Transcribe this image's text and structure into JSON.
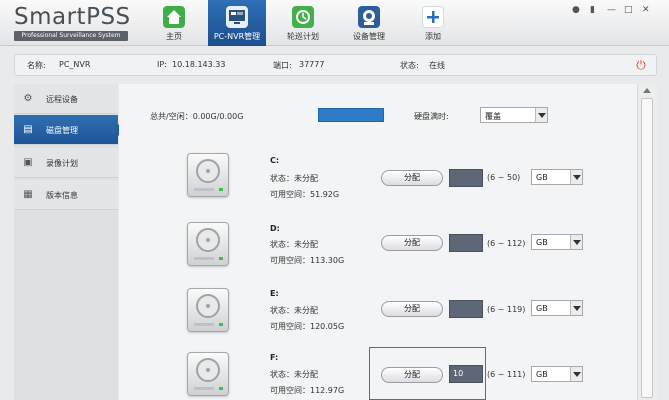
{
  "app": {
    "logo_title": "SmartPSS",
    "logo_subtitle": "Professional Surveillance System"
  },
  "nav": [
    {
      "label": "主页",
      "icon": "home-icon",
      "color": "#3fae49"
    },
    {
      "label": "PC-NVR管理",
      "icon": "pc-nvr-icon",
      "color": "#2c4f7c"
    },
    {
      "label": "轮巡计划",
      "icon": "patrol-schedule-icon",
      "color": "#43b14b"
    },
    {
      "label": "设备管理",
      "icon": "camera-device-icon",
      "color": "#2f5d9a"
    },
    {
      "label": "添加",
      "icon": "add-icon",
      "color": "#2a6fbf"
    }
  ],
  "window_controls": [
    "user-icon",
    "lock-icon",
    "minimize-icon",
    "restore-icon",
    "close-icon"
  ],
  "info": {
    "name_label": "名称:",
    "name_value": "PC_NVR",
    "ip_label": "IP:",
    "ip_value": "10.18.143.33",
    "port_label": "端口:",
    "port_value": "37777",
    "status_label": "状态:",
    "status_value": "在线"
  },
  "sidebar": [
    {
      "label": "远程设备",
      "icon": "gear-icon",
      "active": false
    },
    {
      "label": "磁盘管理",
      "icon": "disk-icon",
      "active": true
    },
    {
      "label": "录像计划",
      "icon": "record-schedule-icon",
      "active": false
    },
    {
      "label": "版本信息",
      "icon": "info-icon",
      "active": false
    }
  ],
  "disk": {
    "total_label": "总共/空闲：0.00G/0.00G",
    "full_label": "硬盘满时:",
    "full_option": "覆盖",
    "drives": [
      {
        "name": "C:",
        "status": "状态：未分配",
        "space": "可用空间：51.92G",
        "button": "分配",
        "size": "",
        "range": "(6 ~ 50)",
        "unit": "GB"
      },
      {
        "name": "D:",
        "status": "状态：未分配",
        "space": "可用空间：113.30G",
        "button": "分配",
        "size": "",
        "range": "(6 ~ 112)",
        "unit": "GB"
      },
      {
        "name": "E:",
        "status": "状态：未分配",
        "space": "可用空间：120.05G",
        "button": "分配",
        "size": "",
        "range": "(6 ~ 119)",
        "unit": "GB"
      },
      {
        "name": "F:",
        "status": "状态：未分配",
        "space": "可用空间：112.97G",
        "button": "分配",
        "size": "10",
        "range": "(6 ~ 111)",
        "unit": "GB"
      }
    ]
  },
  "colors": {
    "accent": "#1e5596",
    "highlight": "#e03a2a",
    "total_bar": "#2e7cc8"
  }
}
